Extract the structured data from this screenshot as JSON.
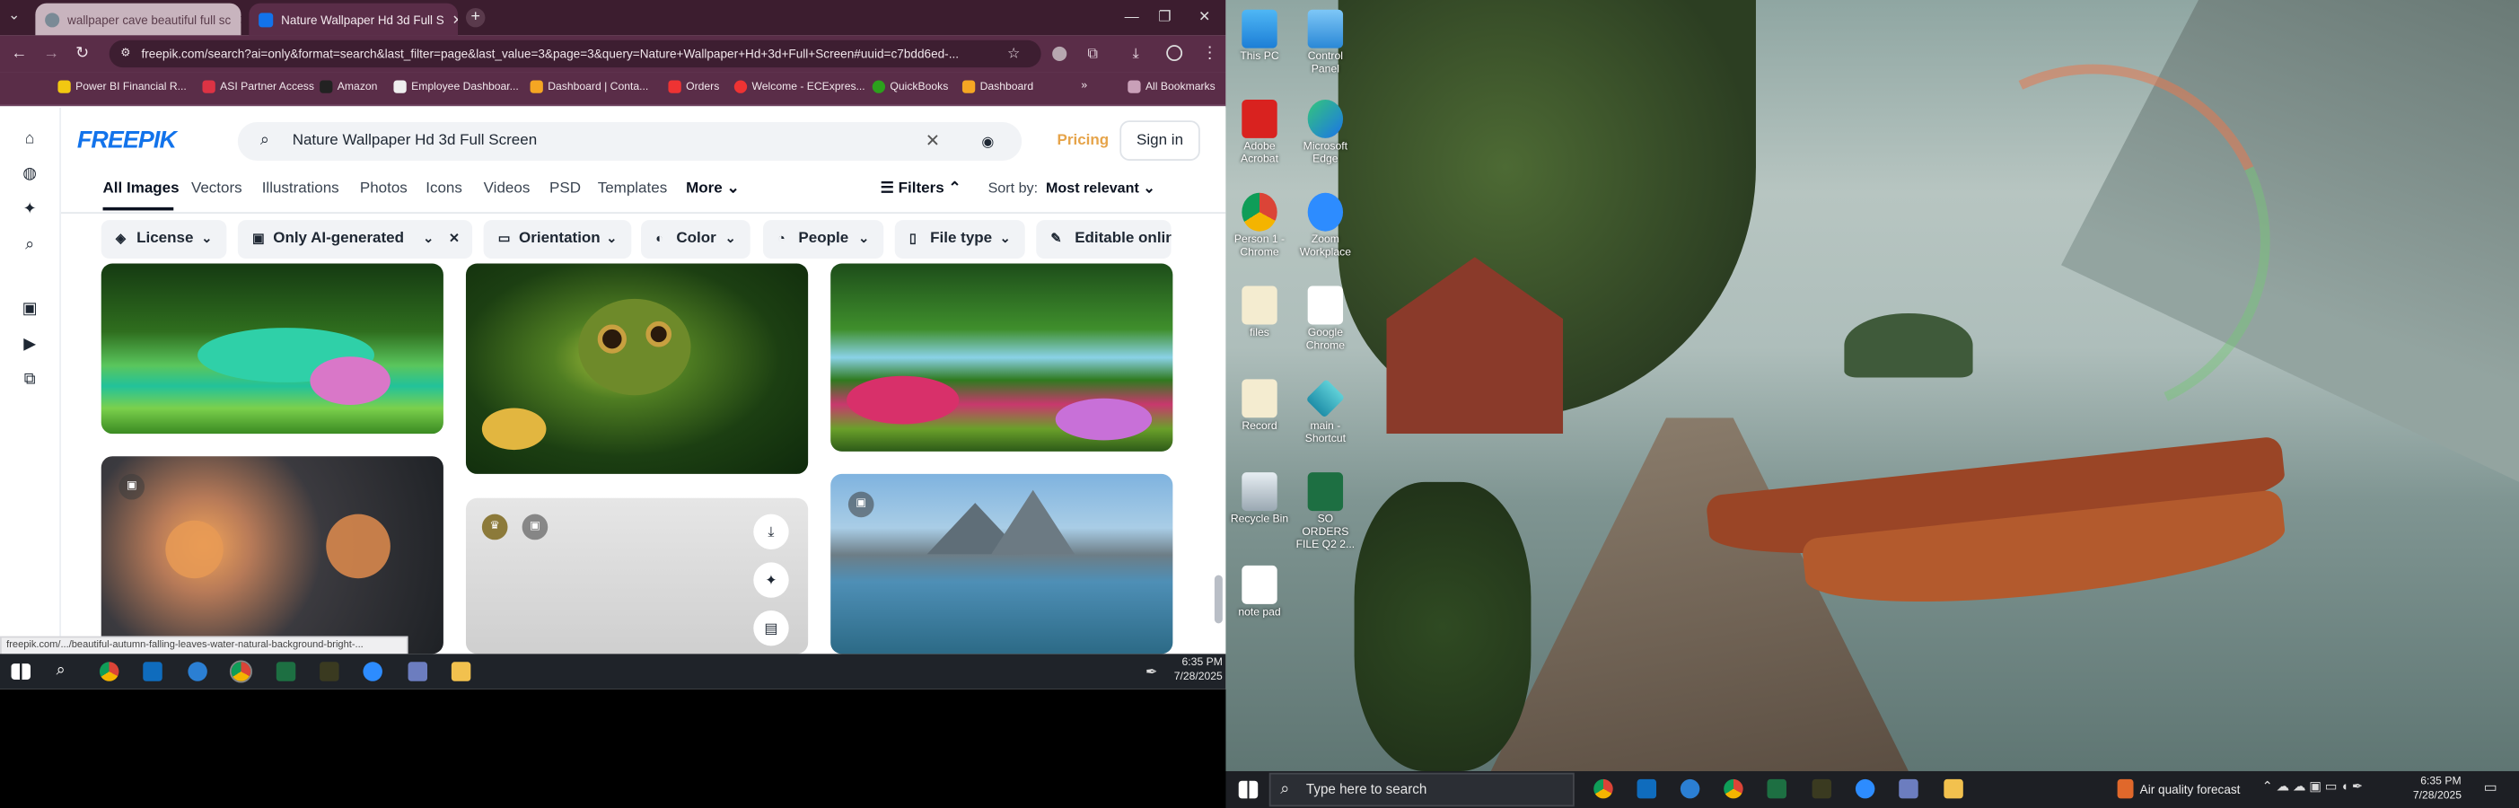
{
  "browser": {
    "tabs": [
      {
        "label": "wallpaper cave beautiful full sc",
        "active": false
      },
      {
        "label": "Nature Wallpaper Hd 3d Full S",
        "active": true
      }
    ],
    "url": "freepik.com/search?ai=only&format=search&last_filter=page&last_value=3&page=3&query=Nature+Wallpaper+Hd+3d+Full+Screen#uuid=c7bdd6ed-...",
    "bookmarks": [
      "Power BI Financial R...",
      "ASI Partner Access",
      "Amazon",
      "Employee Dashboar...",
      "Dashboard | Conta...",
      "Orders",
      "Welcome - ECExpres...",
      "QuickBooks",
      "Dashboard"
    ],
    "all_bookmarks": "All Bookmarks",
    "status_url": "freepik.com/.../beautiful-autumn-falling-leaves-water-natural-background-bright-..."
  },
  "freepik": {
    "logo": "FREEPIK",
    "search_value": "Nature Wallpaper Hd 3d Full Screen",
    "pricing": "Pricing",
    "signin": "Sign in",
    "categories": [
      "All Images",
      "Vectors",
      "Illustrations",
      "Photos",
      "Icons",
      "Videos",
      "PSD",
      "Templates",
      "More"
    ],
    "filters": "Filters",
    "sort_label": "Sort by:",
    "sort_value": "Most relevant",
    "chips": [
      "License",
      "Only AI-generated",
      "Orientation",
      "Color",
      "People",
      "File type",
      "Editable online"
    ]
  },
  "taskbar_left": {
    "time": "6:35 PM",
    "date": "7/28/2025"
  },
  "desktop": {
    "icons": [
      "This PC",
      "Control Panel",
      "Adobe Acrobat",
      "Microsoft Edge",
      "Person 1 - Chrome",
      "Zoom Workplace",
      "files",
      "Google Chrome",
      "Record",
      "main - Shortcut",
      "Recycle Bin",
      "SO ORDERS FILE Q2 2...",
      "note pad"
    ]
  },
  "taskbar_right": {
    "search_placeholder": "Type here to search",
    "weather": "Air quality forecast",
    "time": "6:35 PM",
    "date": "7/28/2025"
  },
  "colors": {
    "freepik_blue": "#1273eb",
    "chrome_frame": "#5a2d48",
    "pricing": "#e6a44a"
  }
}
